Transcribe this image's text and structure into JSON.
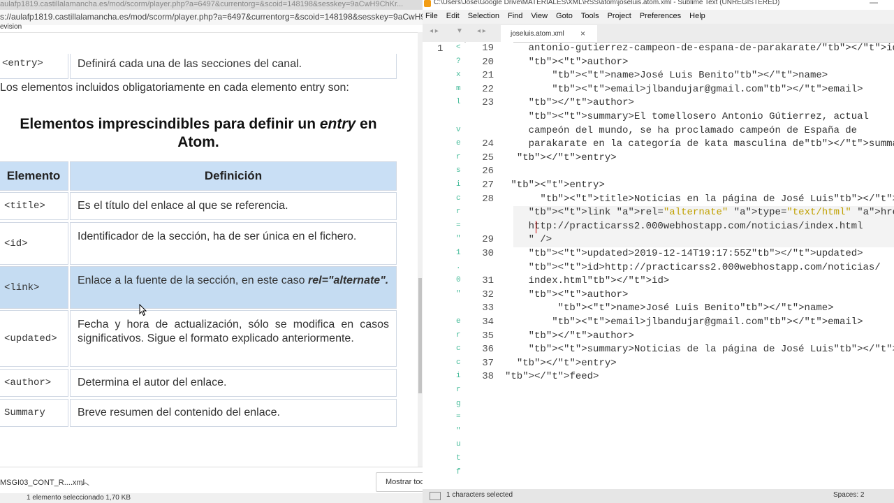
{
  "browser": {
    "title_bar": "aulafp1819.castillalamancha.es/mod/scorm/player.php?a=6497&currentorg=&scoid=148198&sesskey=9aCwH9ChKr...",
    "url": "s://aulafp1819.castillalamancha.es/mod/scorm/player.php?a=6497&currentorg=&scoid=148198&sesskey=9aCwH9ChKr",
    "revision_label": "evision",
    "top_row": {
      "tag": "<entry>",
      "text": "Definirá cada una de las secciones del canal."
    },
    "intro": "Los elementos incluidos obligatoriamente en cada elemento entry son:",
    "heading_part1": "Elementos imprescindibles para definir un ",
    "heading_em": "entry",
    "heading_part2": " en",
    "heading_line2": "Atom.",
    "table": {
      "headers": [
        "Elemento",
        "Definición"
      ],
      "rows": [
        {
          "tag": "<title>",
          "def": "Es el título del enlace al que se referencia."
        },
        {
          "tag": "<id>",
          "def": "Identificador de la sección, ha de ser única en el fichero."
        },
        {
          "tag": "<link>",
          "def": "Enlace a la fuente de la sección, en este caso ",
          "def_em": "rel=\"alternate\"."
        },
        {
          "tag": "<updated>",
          "def": "Fecha y hora de actualización, sólo se modifica en casos significativos. Sigue el formato explicado anteriormente."
        },
        {
          "tag": "<author>",
          "def": "Determina el autor del enlace."
        },
        {
          "tag": "Summary",
          "def": "Breve resumen del contenido del enlace."
        }
      ]
    },
    "download_file": "MSGI03_CONT_R....xml",
    "download_button": "Mostrar toc",
    "status": "1 elemento seleccionado  1,70 KB"
  },
  "editor": {
    "title": "C:\\Users\\Jose\\Google Drive\\MATERIALES\\XML\\RSS\\atom\\joseluis.atom.xml - Sublime Text (UNREGISTERED)",
    "menu": [
      "File",
      "Edit",
      "Selection",
      "Find",
      "View",
      "Goto",
      "Tools",
      "Project",
      "Preferences",
      "Help"
    ],
    "tab_label": "joseluis.atom.xml",
    "tab_close": "×",
    "gutter_left": [
      "1"
    ],
    "line_numbers": [
      "19",
      "20",
      "21",
      "22",
      "23",
      "",
      "",
      "24",
      "25",
      "26",
      "27",
      "28",
      "",
      "",
      "29",
      "30",
      "",
      "31",
      "32",
      "33",
      "34",
      "35",
      "36",
      "37",
      "38"
    ],
    "code_lines": [
      "    antonio-gutierrez-campeon-de-espana-de-parakarate/</id>",
      "    <author>",
      "        <name>José Luis Benito</name>",
      "        <email>jlbandujar@gmail.com</email>",
      "    </author>",
      "    <summary>El tomellosero Antonio Gútierrez, actual",
      "    campeón del mundo, se ha proclamado campeón de España de",
      "    parakarate en la categoría de kata masculina de</summary>",
      "  </entry>",
      "",
      " <entry>",
      "      <title>Noticias en la página de José Luis</title>",
      "    <link rel=\"alternate\" type=\"text/html\" href=\"",
      "    http://practicarss2.000webhostapp.com/noticias/index.html",
      "    \" />",
      "    <updated>2019-12-14T19:17:55Z</updated>",
      "    <id>http://practicarss2.000webhostapp.com/noticias/",
      "    index.html</id>",
      "    <author>",
      "         <name>José Luis Benito</name>",
      "        <email>jlbandujar@gmail.com</email>",
      "    </author>",
      "    <summary>Noticias de la página de José Luis</summary>",
      "  </entry>",
      "</feed>",
      ""
    ],
    "minimap_chars": [
      "<",
      "?",
      "x",
      "m",
      "l",
      "",
      "v",
      "e",
      "r",
      "s",
      "i",
      "c",
      "r",
      "=",
      "\"",
      "1",
      ".",
      "0",
      "\"",
      "",
      "e",
      "r",
      "c",
      "c",
      "i",
      "r",
      "g",
      "=",
      "\"",
      "u",
      "t",
      "f"
    ],
    "status_left": "1 characters selected",
    "status_right": "Spaces: 2"
  }
}
